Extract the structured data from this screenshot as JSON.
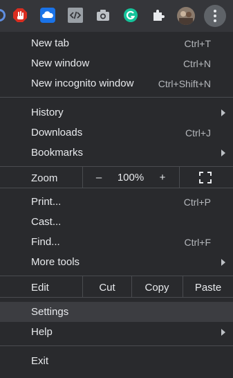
{
  "toolbar": {
    "icons": [
      "partial-circle-icon",
      "adblock-hand-icon",
      "cloud-icon",
      "code-icon",
      "camera-icon",
      "grammarly-icon",
      "puzzle-icon",
      "profile-avatar",
      "more-options-icon"
    ]
  },
  "menu": {
    "new_tab": {
      "label": "New tab",
      "shortcut": "Ctrl+T"
    },
    "new_window": {
      "label": "New window",
      "shortcut": "Ctrl+N"
    },
    "new_incognito": {
      "label": "New incognito window",
      "shortcut": "Ctrl+Shift+N"
    },
    "history": {
      "label": "History"
    },
    "downloads": {
      "label": "Downloads",
      "shortcut": "Ctrl+J"
    },
    "bookmarks": {
      "label": "Bookmarks"
    },
    "zoom": {
      "label": "Zoom",
      "minus": "–",
      "value": "100%",
      "plus": "+"
    },
    "print": {
      "label": "Print...",
      "shortcut": "Ctrl+P"
    },
    "cast": {
      "label": "Cast..."
    },
    "find": {
      "label": "Find...",
      "shortcut": "Ctrl+F"
    },
    "more_tools": {
      "label": "More tools"
    },
    "edit": {
      "label": "Edit",
      "cut": "Cut",
      "copy": "Copy",
      "paste": "Paste"
    },
    "settings": {
      "label": "Settings"
    },
    "help": {
      "label": "Help"
    },
    "exit": {
      "label": "Exit"
    }
  },
  "colors": {
    "background": "#292a2d",
    "toolbar": "#35363a",
    "highlight": "#3c3d41",
    "text": "#e8eaed"
  }
}
